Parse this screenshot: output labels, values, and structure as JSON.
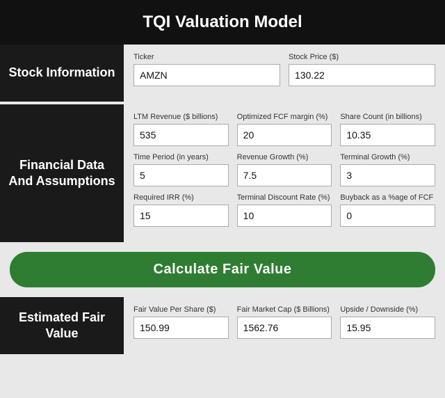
{
  "header": {
    "title": "TQI Valuation Model"
  },
  "stock_section": {
    "label": "Stock Information",
    "ticker_label": "Ticker",
    "ticker_value": "AMZN",
    "price_label": "Stock Price ($)",
    "price_value": "130.22"
  },
  "financial_section": {
    "label": "Financial Data And Assumptions",
    "row1": [
      {
        "label": "LTM Revenue ($ billions)",
        "value": "535"
      },
      {
        "label": "Optimized FCF margin (%)",
        "value": "20"
      },
      {
        "label": "Share Count (in billions)",
        "value": "10.35"
      }
    ],
    "row2": [
      {
        "label": "Time Period (in years)",
        "value": "5"
      },
      {
        "label": "Revenue Growth (%)",
        "value": "7.5"
      },
      {
        "label": "Terminal Growth (%)",
        "value": "3"
      }
    ],
    "row3": [
      {
        "label": "Required IRR (%)",
        "value": "15"
      },
      {
        "label": "Terminal Discount Rate (%)",
        "value": "10"
      },
      {
        "label": "Buyback as a %age of FCF",
        "value": "0"
      }
    ]
  },
  "calculate_btn": {
    "label": "Calculate Fair Value"
  },
  "efv_section": {
    "label": "Estimated Fair Value",
    "row1": [
      {
        "label": "Fair Value Per Share ($)",
        "value": "150.99"
      },
      {
        "label": "Fair Market Cap ($ Billions)",
        "value": "1562.76"
      },
      {
        "label": "Upside / Downside (%)",
        "value": "15.95"
      }
    ]
  }
}
